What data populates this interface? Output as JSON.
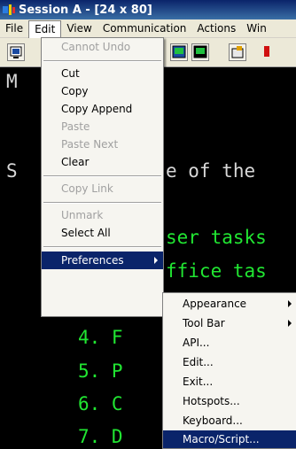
{
  "window": {
    "title": "Session A - [24 x 80]"
  },
  "menubar": {
    "items": [
      "File",
      "Edit",
      "View",
      "Communication",
      "Actions",
      "Win"
    ]
  },
  "edit_menu": {
    "items": [
      {
        "label": "Cannot Undo",
        "enabled": false
      },
      {
        "label": "Cut",
        "enabled": true
      },
      {
        "label": "Copy",
        "enabled": true
      },
      {
        "label": "Copy Append",
        "enabled": true
      },
      {
        "label": "Paste",
        "enabled": false
      },
      {
        "label": "Paste Next",
        "enabled": false
      },
      {
        "label": "Clear",
        "enabled": true
      },
      {
        "label": "Copy Link",
        "enabled": false
      },
      {
        "label": "Unmark",
        "enabled": false
      },
      {
        "label": "Select All",
        "enabled": true
      },
      {
        "label": "Preferences",
        "enabled": true,
        "highlighted": true,
        "submenu": true
      }
    ]
  },
  "preferences_menu": {
    "items": [
      {
        "label": "Appearance",
        "submenu": true
      },
      {
        "label": "Tool Bar",
        "submenu": true
      },
      {
        "label": "API..."
      },
      {
        "label": "Edit..."
      },
      {
        "label": "Exit..."
      },
      {
        "label": "Hotspots..."
      },
      {
        "label": "Keyboard..."
      },
      {
        "label": "Macro/Script...",
        "highlighted": true
      }
    ]
  },
  "terminal": {
    "lines": {
      "m": "M",
      "s": "S",
      "of_the": "e of the",
      "ser_tasks": "ser tasks",
      "ffice_tas": "ffice tas",
      "n4": "4. F",
      "n5": "5. P",
      "n6": "6. C",
      "n7": "7. D"
    }
  },
  "colors": {
    "terminal_bg": "#000000",
    "terminal_green": "#21e632",
    "menu_highlight": "#0a246a",
    "title_bar": "#0a246a"
  }
}
